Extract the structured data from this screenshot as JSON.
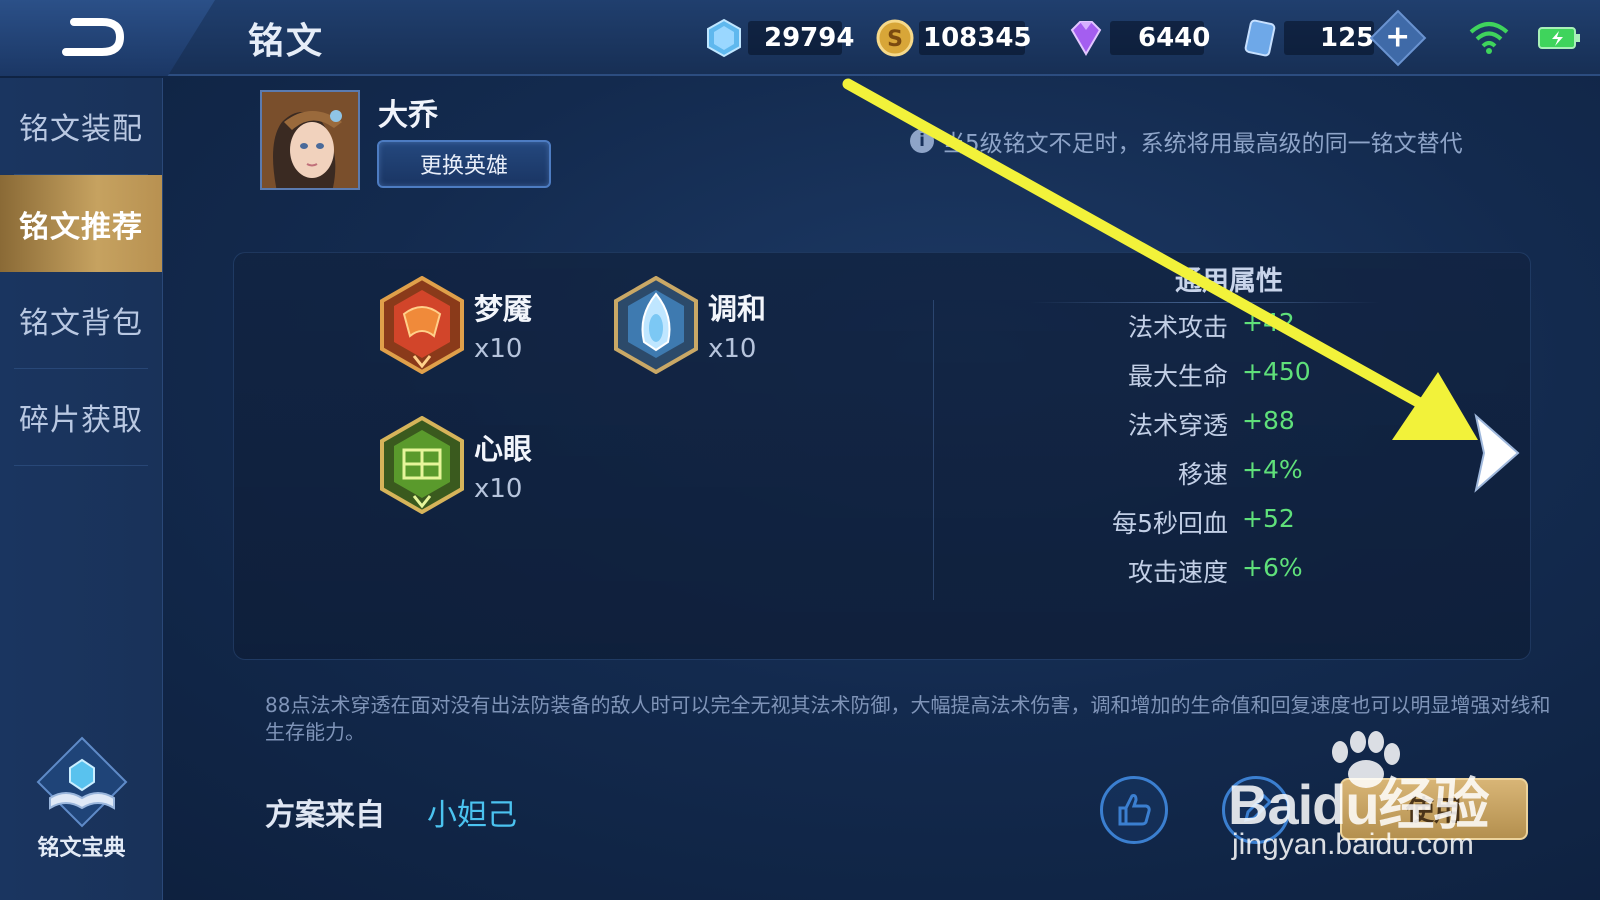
{
  "header": {
    "title": "铭文",
    "currencies": [
      {
        "name": "diamond-crystal",
        "value": "29794"
      },
      {
        "name": "gold-coin",
        "value": "108345"
      },
      {
        "name": "purple-gem",
        "value": "6440"
      },
      {
        "name": "card-ticket",
        "value": "125"
      }
    ],
    "colors": {
      "topbar": "#1b3765",
      "accent_gold": "#c6a260",
      "positive_stat": "#5fe07a",
      "author_link": "#4bc3f0"
    }
  },
  "sidebar": {
    "items": [
      {
        "label": "铭文装配",
        "active": false
      },
      {
        "label": "铭文推荐",
        "active": true
      },
      {
        "label": "铭文背包",
        "active": false
      },
      {
        "label": "碎片获取",
        "active": false
      }
    ],
    "codex_label": "铭文宝典"
  },
  "hero": {
    "name": "大乔",
    "change_button": "更换英雄",
    "note": "当5级铭文不足时，系统将用最高级的同一铭文替代"
  },
  "runes": [
    {
      "name": "梦魇",
      "count": "x10",
      "color": "red"
    },
    {
      "name": "调和",
      "count": "x10",
      "color": "blue"
    },
    {
      "name": "心眼",
      "count": "x10",
      "color": "green"
    }
  ],
  "attributes": {
    "title": "通用属性",
    "rows": [
      {
        "name": "法术攻击",
        "value": "+42"
      },
      {
        "name": "最大生命",
        "value": "+450"
      },
      {
        "name": "法术穿透",
        "value": "+88"
      },
      {
        "name": "移速",
        "value": "+4%"
      },
      {
        "name": "每5秒回血",
        "value": "+52"
      },
      {
        "name": "攻击速度",
        "value": "+6%"
      }
    ]
  },
  "description": "88点法术穿透在面对没有出法防装备的敌人时可以完全无视其法术防御，大幅提高法术伤害，调和增加的生命值和回复速度也可以明显增强对线和生存能力。",
  "footer": {
    "source_label": "方案来自",
    "source_author": "小妲己",
    "use_button": "使用"
  },
  "watermark": {
    "main": "Baidu经验",
    "sub": "jingyan.baidu.com"
  }
}
